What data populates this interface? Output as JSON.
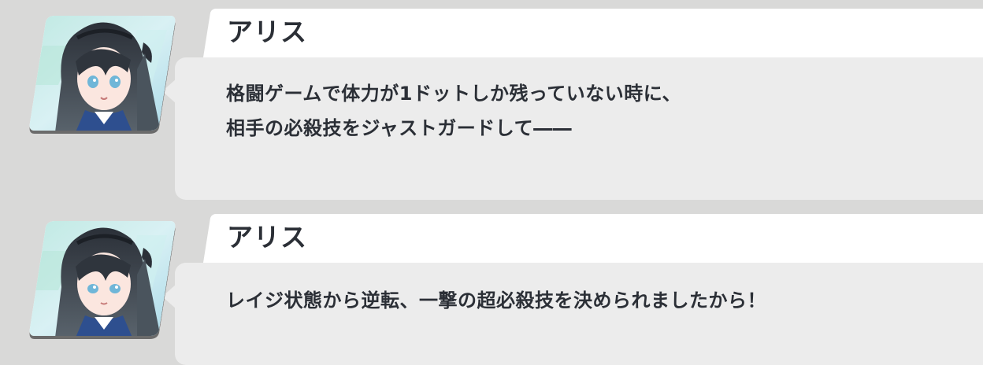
{
  "messages": [
    {
      "speaker": "アリス",
      "avatar_icon": "aris-portrait-icon",
      "text": "格闘ゲームで体力が1ドットしか残っていない時に、\n相手の必殺技をジャストガードして――"
    },
    {
      "speaker": "アリス",
      "avatar_icon": "aris-portrait-icon",
      "text": "レイジ状態から逆転、一撃の超必殺技を決められましたから！"
    }
  ],
  "colors": {
    "background": "#d9d9d8",
    "name_bar": "#ffffff",
    "bubble": "#ececec",
    "text": "#2b2f36"
  }
}
